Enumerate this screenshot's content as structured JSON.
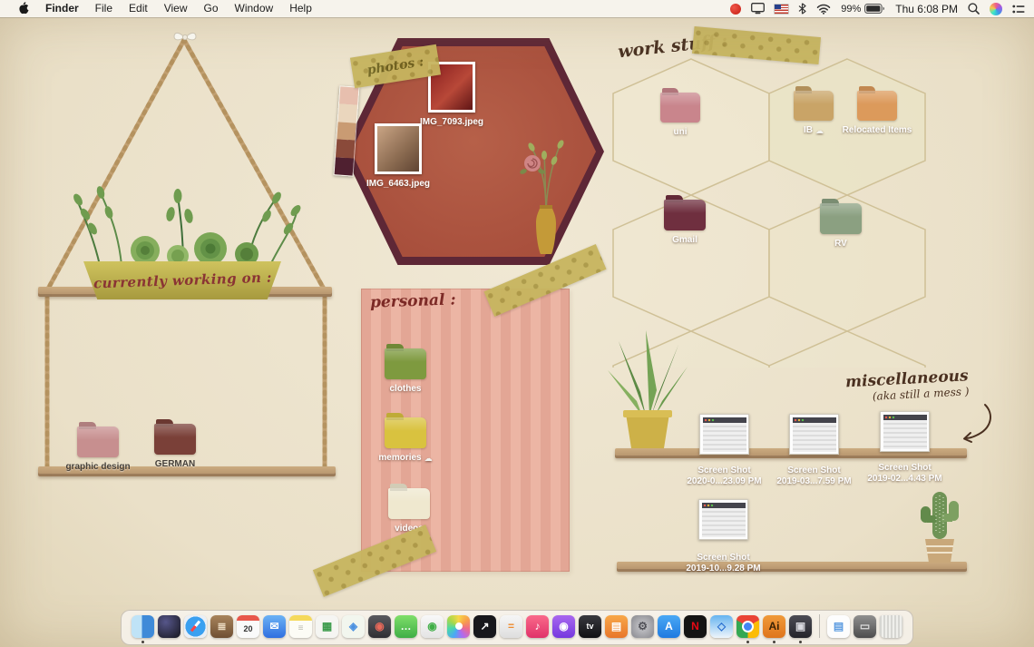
{
  "menu_bar": {
    "app_name": "Finder",
    "menus": [
      "File",
      "Edit",
      "View",
      "Go",
      "Window",
      "Help"
    ],
    "status": {
      "battery": "99%",
      "time": "Thu 6:08 PM"
    },
    "status_icons": [
      "red-app",
      "display",
      "input-source-us-flag",
      "bluetooth",
      "wifi",
      "battery",
      "spotlight",
      "siri",
      "control-center"
    ]
  },
  "desktop": {
    "working_on": {
      "label": "currently working on :",
      "folders": [
        {
          "name": "graphic design",
          "color": "#c78f8f"
        },
        {
          "name": "GERMAN",
          "color": "#7a4038"
        }
      ]
    },
    "photos": {
      "label": "photos :",
      "files": [
        {
          "name": "IMG_7093.jpeg"
        },
        {
          "name": "IMG_6463.jpeg"
        }
      ]
    },
    "personal": {
      "label": "personal :",
      "folders": [
        {
          "name": "clothes",
          "color": "#7e9a3f"
        },
        {
          "name": "memories",
          "color": "#d9c23f",
          "cloud": "☁"
        },
        {
          "name": "videos",
          "color": "#efe8cf"
        }
      ]
    },
    "work": {
      "label": "work stuff :",
      "folders": [
        {
          "name": "uni",
          "color": "#c9858c"
        },
        {
          "name": "IB",
          "color": "#c9a467",
          "cloud": "☁"
        },
        {
          "name": "Relocated Items",
          "color": "#dc9a5b"
        },
        {
          "name": "Gmail",
          "color": "#6f2f3f"
        },
        {
          "name": "RV",
          "color": "#8ba081"
        }
      ]
    },
    "misc": {
      "line1": "miscellaneous",
      "line2": "(aka still a mess )",
      "files": [
        {
          "line1": "Screen Shot",
          "line2": "2020-0...23.09 PM"
        },
        {
          "line1": "Screen Shot",
          "line2": "2019-03...7.59 PM"
        },
        {
          "line1": "Screen Shot",
          "line2": "2019-02...4.43 PM"
        },
        {
          "line1": "Screen Shot",
          "line2": "2019-10...9.28 PM"
        }
      ]
    },
    "decorations": [
      "ribbon-bow",
      "hanging-rope-shelf",
      "plants",
      "planter-banner",
      "hexagon-pinboard",
      "washi-tape",
      "color-palette",
      "rose-doodle",
      "vase-with-stems",
      "honeycomb-grid",
      "aloe-pot-plant",
      "cactus-pot-plant",
      "arrow-doodle",
      "wood-shelves"
    ]
  },
  "dock": {
    "items": [
      {
        "name": "finder",
        "bg": "linear-gradient(90deg,#bfe3f7 0 46%,#3f8ad8 46%)",
        "dot": true
      },
      {
        "name": "siri",
        "bg": "radial-gradient(circle at 35% 30%,#56568a,#16161e)"
      },
      {
        "name": "safari",
        "bg": "radial-gradient(circle at 50% 50%,#3aa0f0 62%,#e9eff6 63%)",
        "cls": "ic-safari"
      },
      {
        "name": "journal",
        "bg": "linear-gradient(180deg,#a8845c,#6f4f33)",
        "glyph": "≣",
        "fg": "#ead9bf"
      },
      {
        "name": "calendar",
        "bg": "#fafafa",
        "cls": "ic-calendar",
        "glyph": "20",
        "fg": "#333"
      },
      {
        "name": "mail",
        "bg": "linear-gradient(180deg,#6cb2f5,#2f6fe0)",
        "glyph": "✉",
        "fg": "#fff"
      },
      {
        "name": "notes",
        "bg": "#fcfcf6",
        "cls": "ic-notes",
        "glyph": "≡",
        "fg": "#b9b9ae"
      },
      {
        "name": "numbers",
        "bg": "#f5f5f2",
        "glyph": "▦",
        "fg": "#3a9a4a"
      },
      {
        "name": "maps",
        "bg": "#f2f6ee",
        "glyph": "◈",
        "fg": "#4a90e0"
      },
      {
        "name": "photo-booth",
        "bg": "linear-gradient(180deg,#5a5a60,#2e2e33)",
        "glyph": "◉",
        "fg": "#e8695a"
      },
      {
        "name": "messages",
        "bg": "linear-gradient(180deg,#7fdf6a,#3fae46)",
        "glyph": "…",
        "fg": "#fff"
      },
      {
        "name": "facetime",
        "bg": "linear-gradient(180deg,#f8f8f8,#e4e4e4)",
        "glyph": "◉",
        "fg": "#3fae46"
      },
      {
        "name": "photos",
        "bg": "#fff",
        "cls": "ic-photos"
      },
      {
        "name": "stocks",
        "bg": "#17171c",
        "glyph": "↗",
        "fg": "#fff"
      },
      {
        "name": "calculator",
        "bg": "linear-gradient(180deg,#f6f6f6,#dedede)",
        "glyph": "=",
        "fg": "#ef8b2e"
      },
      {
        "name": "music",
        "bg": "linear-gradient(180deg,#fa6a8a,#e0326a)",
        "glyph": "♪",
        "fg": "#fff"
      },
      {
        "name": "podcasts",
        "bg": "linear-gradient(180deg,#a968ef,#7438df)",
        "glyph": "◉",
        "fg": "#fff"
      },
      {
        "name": "tv",
        "bg": "linear-gradient(180deg,#39393f,#101013)",
        "glyph": "tv",
        "fg": "#fff"
      },
      {
        "name": "books",
        "bg": "linear-gradient(180deg,#f8a84a,#e8762a)",
        "glyph": "▤",
        "fg": "#fff"
      },
      {
        "name": "system-preferences",
        "bg": "radial-gradient(circle,#cacace,#88888e)",
        "glyph": "⚙",
        "fg": "#4e4e55"
      },
      {
        "name": "app-store",
        "bg": "linear-gradient(180deg,#4aa8f5,#1f7ae0)",
        "glyph": "A",
        "fg": "#fff"
      },
      {
        "name": "netflix",
        "bg": "#141414",
        "glyph": "N",
        "fg": "#e50914"
      },
      {
        "name": "blue-doc-app",
        "bg": "linear-gradient(180deg,#66b4f0,#eef5fb)",
        "glyph": "◇",
        "fg": "#2a6fd0"
      },
      {
        "name": "chrome",
        "bg": "#fff",
        "cls": "ic-chrome",
        "dot": true
      },
      {
        "name": "illustrator",
        "bg": "linear-gradient(180deg,#f09a3a,#df751d)",
        "glyph": "Ai",
        "fg": "#3a2204",
        "dot": true
      },
      {
        "name": "screenshot-utility",
        "bg": "linear-gradient(180deg,#4c4c55,#24242b)",
        "glyph": "▣",
        "fg": "#d8d8de",
        "dot": true
      },
      {
        "divider": true
      },
      {
        "name": "pages-document",
        "bg": "#fdfdfd",
        "glyph": "▤",
        "fg": "#5a9ae0"
      },
      {
        "name": "minimized-window",
        "bg": "linear-gradient(180deg,#909090,#4c4c4c)",
        "glyph": "▭",
        "fg": "#ddd"
      },
      {
        "name": "trash",
        "bg": "repeating-linear-gradient(90deg,#d6d6d2 0 2px,#efefeb 2px 4px)",
        "cls": "ic-trash"
      }
    ]
  }
}
